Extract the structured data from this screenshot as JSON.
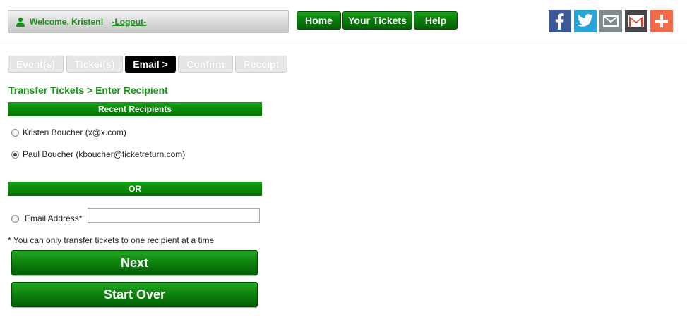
{
  "header": {
    "welcome_text": "Welcome, Kristen!",
    "logout_label": "-Logout-",
    "nav": {
      "home": "Home",
      "your_tickets": "Your Tickets",
      "help": "Help"
    },
    "social": [
      {
        "icon": "facebook-icon",
        "color": "#3b5998"
      },
      {
        "icon": "twitter-icon",
        "color": "#2aa3d6"
      },
      {
        "icon": "email-icon",
        "color": "#7f8c8d"
      },
      {
        "icon": "gmail-icon",
        "color": "#444444"
      },
      {
        "icon": "share-plus-icon",
        "color": "#f26b4b"
      }
    ]
  },
  "steps": {
    "events": "Event(s)",
    "tickets": "Ticket(s)",
    "email": "Email >",
    "confirm": "Confirm",
    "receipt": "Receipt",
    "active": "email"
  },
  "transfer": {
    "title": "Transfer Tickets > Enter Recipient",
    "recent_header": "Recent Recipients",
    "recipients": [
      {
        "label": "Kristen Boucher (x@x.com)",
        "selected": false
      },
      {
        "label": "Paul Boucher (kboucher@ticketreturn.com)",
        "selected": true
      }
    ],
    "or_label": "OR",
    "email_label": "Email Address*",
    "email_value": "",
    "note": "* You can only transfer tickets to one recipient at a time",
    "next_label": "Next",
    "start_over_label": "Start Over"
  },
  "colors": {
    "brand_green": "#0a8a0a",
    "title_green": "#1a8f1a",
    "active_step": "#000000",
    "inactive_step": "#e6e6e6"
  }
}
